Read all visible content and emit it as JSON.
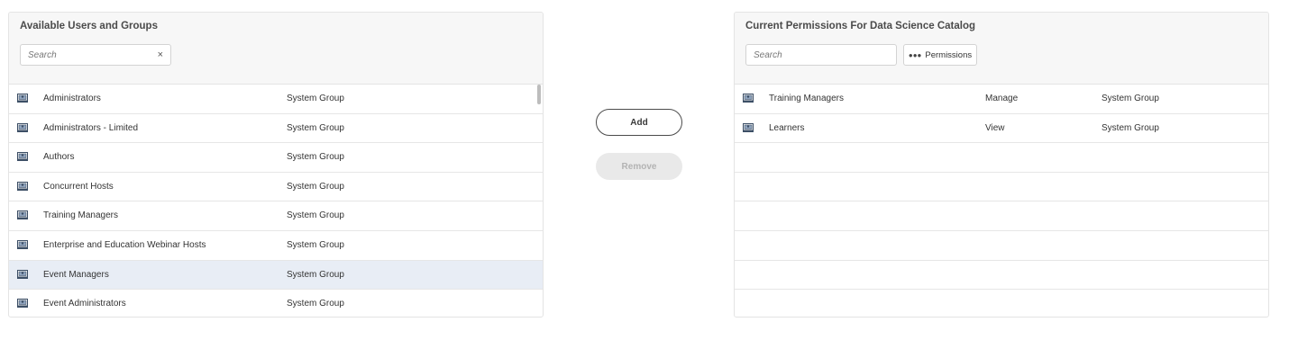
{
  "left_panel": {
    "title": "Available Users and Groups",
    "search_placeholder": "Search",
    "clear_label": "×",
    "rows": [
      {
        "name": "Administrators",
        "type": "System Group"
      },
      {
        "name": "Administrators - Limited",
        "type": "System Group"
      },
      {
        "name": "Authors",
        "type": "System Group"
      },
      {
        "name": "Concurrent Hosts",
        "type": "System Group"
      },
      {
        "name": "Training Managers",
        "type": "System Group"
      },
      {
        "name": "Enterprise and Education Webinar Hosts",
        "type": "System Group"
      },
      {
        "name": "Event Managers",
        "type": "System Group",
        "selected": true
      },
      {
        "name": "Event Administrators",
        "type": "System Group"
      }
    ]
  },
  "actions": {
    "add_label": "Add",
    "remove_label": "Remove"
  },
  "right_panel": {
    "title": "Current Permissions For Data Science Catalog",
    "search_placeholder": "Search",
    "permissions_button_label": "Permissions",
    "permissions_button_icon": "more-dots-icon",
    "rows": [
      {
        "name": "Training Managers",
        "permission": "Manage",
        "type": "System Group"
      },
      {
        "name": "Learners",
        "permission": "View",
        "type": "System Group"
      }
    ],
    "empty_rows": 6
  },
  "colors": {
    "selected_row": "#e8edf5",
    "header_bg": "#f7f7f7",
    "group_icon": "#3d4f66"
  },
  "icons": {
    "group": "group-icon"
  }
}
